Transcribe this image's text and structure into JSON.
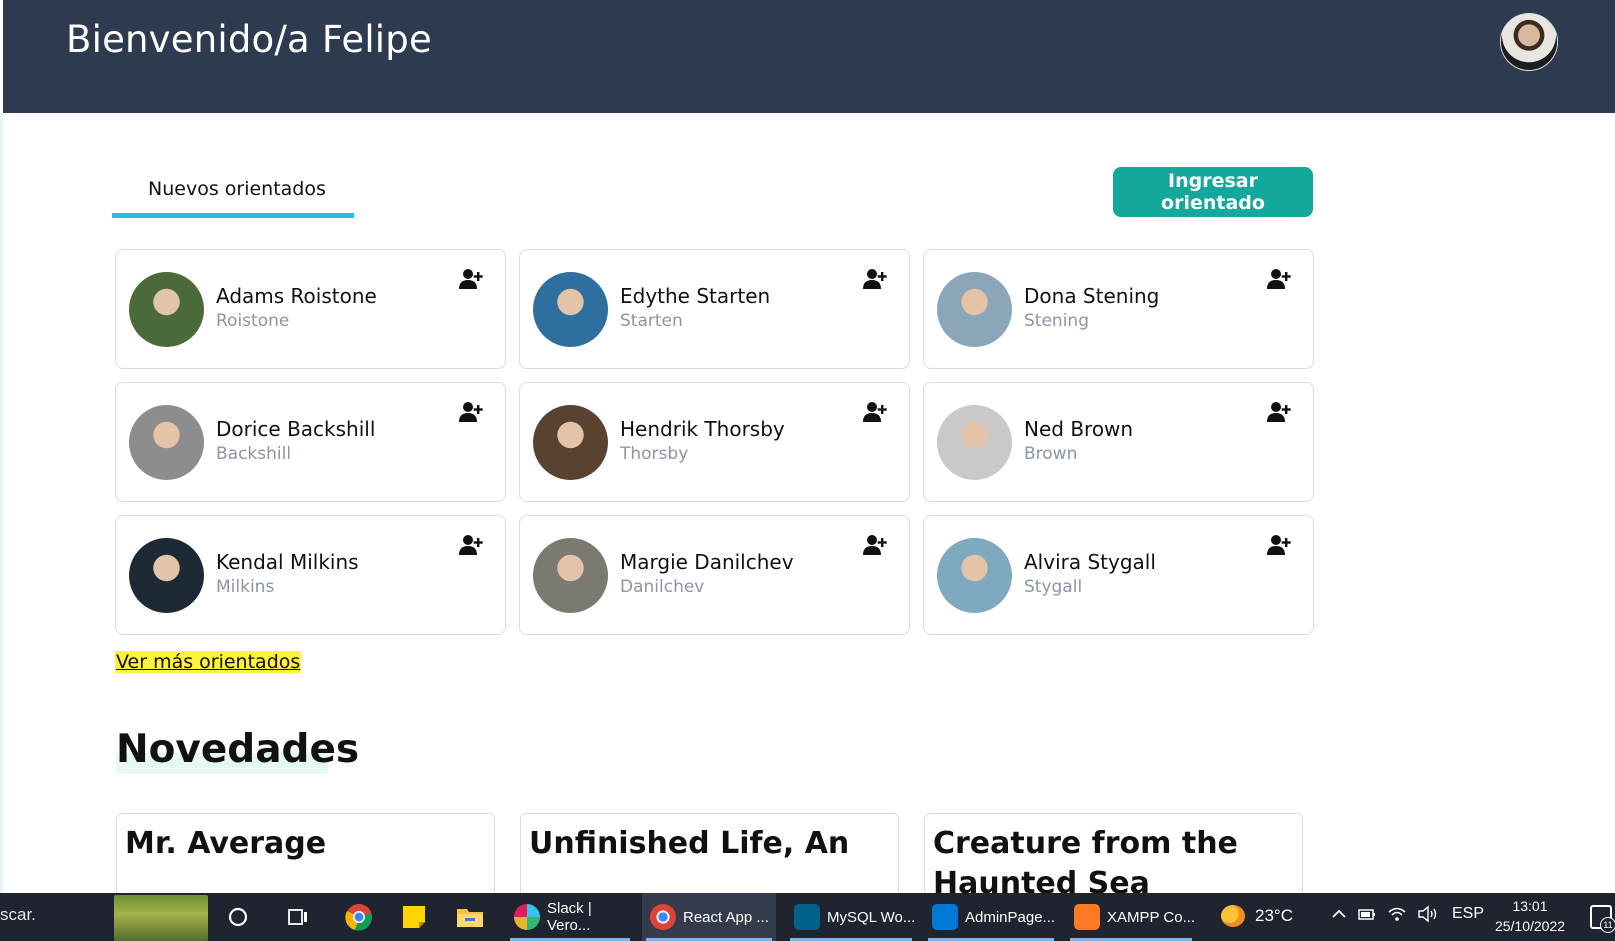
{
  "header": {
    "welcome": "Bienvenido/a Felipe"
  },
  "tabs": {
    "active_label": "Nuevos orientados"
  },
  "actions": {
    "ingresar_label": "Ingresar orientado",
    "ver_mas_label": "Ver más orientados"
  },
  "orientados": [
    {
      "name": "Adams Roistone",
      "sub": "Roistone",
      "photo_color": "#4b6a3a"
    },
    {
      "name": "Edythe Starten",
      "sub": "Starten",
      "photo_color": "#2f6f9f"
    },
    {
      "name": "Dona Stening",
      "sub": "Stening",
      "photo_color": "#8aa6b8"
    },
    {
      "name": "Dorice Backshill",
      "sub": "Backshill",
      "photo_color": "#8d8d8d"
    },
    {
      "name": "Hendrik Thorsby",
      "sub": "Thorsby",
      "photo_color": "#5a4230"
    },
    {
      "name": "Ned Brown",
      "sub": "Brown",
      "photo_color": "#c9c9c9"
    },
    {
      "name": "Kendal Milkins",
      "sub": "Milkins",
      "photo_color": "#1d2a36"
    },
    {
      "name": "Margie Danilchev",
      "sub": "Danilchev",
      "photo_color": "#7a7a70"
    },
    {
      "name": "Alvira Stygall",
      "sub": "Stygall",
      "photo_color": "#7fa9c0"
    }
  ],
  "novedades": {
    "heading": "Novedades",
    "items": [
      {
        "title": "Mr. Average"
      },
      {
        "title": "Unfinished Life, An"
      },
      {
        "title": "Creature from the Haunted Sea"
      }
    ]
  },
  "taskbar": {
    "search_text": "scar.",
    "apps": [
      {
        "label": "Slack | Vero...",
        "color": "#4a154b",
        "active": false
      },
      {
        "label": "React App ...",
        "color": "#e94235",
        "active": true
      },
      {
        "label": "MySQL Wo...",
        "color": "#00618a",
        "active": false
      },
      {
        "label": "AdminPage...",
        "color": "#0078d4",
        "active": false
      },
      {
        "label": "XAMPP Co...",
        "color": "#fb7a24",
        "active": false
      }
    ],
    "weather": "23°C",
    "language": "ESP",
    "time": "13:01",
    "date": "25/10/2022",
    "notification_count": "11"
  },
  "colors": {
    "header_bg": "#2e3a50",
    "accent": "#14a89c",
    "tab_underline": "#1cc4de",
    "highlight": "#fff23a"
  },
  "icons": {
    "add_user": "user-plus-icon",
    "search": "search-icon",
    "task_view": "task-view-icon",
    "chrome": "chrome-icon",
    "sticky_notes": "sticky-notes-icon",
    "file_explorer": "folder-icon"
  }
}
